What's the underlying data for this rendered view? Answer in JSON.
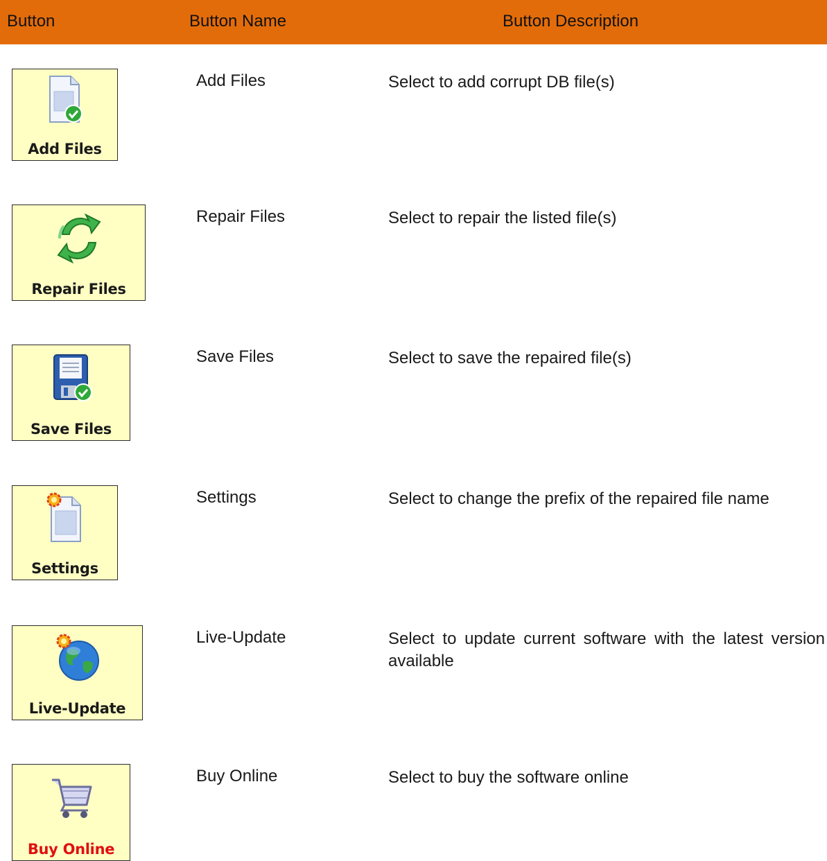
{
  "header": {
    "col_button": "Button",
    "col_name": "Button Name",
    "col_description": "Button Description"
  },
  "rows": [
    {
      "caption": "Add Files",
      "name": "Add Files",
      "description": "Select to add corrupt DB file(s)",
      "icon": "document-check-icon"
    },
    {
      "caption": "Repair Files",
      "name": "Repair Files",
      "description": "Select to repair the listed file(s)",
      "icon": "repair-arrows-icon"
    },
    {
      "caption": "Save Files",
      "name": "Save Files",
      "description": "Select to save the repaired file(s)",
      "icon": "floppy-check-icon"
    },
    {
      "caption": "Settings",
      "name": "Settings",
      "description": "Select to change the prefix of the repaired file name",
      "icon": "settings-document-icon"
    },
    {
      "caption": "Live-Update",
      "name": "Live-Update",
      "description": "Select to update current software with the latest version available",
      "icon": "globe-icon"
    },
    {
      "caption": "Buy Online",
      "name": "Buy Online",
      "description": "Select to buy the software online",
      "icon": "shopping-cart-icon"
    }
  ],
  "colors": {
    "header_bg": "#e36c0a",
    "tile_bg": "#ffffc4",
    "buy_caption": "#e01010"
  }
}
